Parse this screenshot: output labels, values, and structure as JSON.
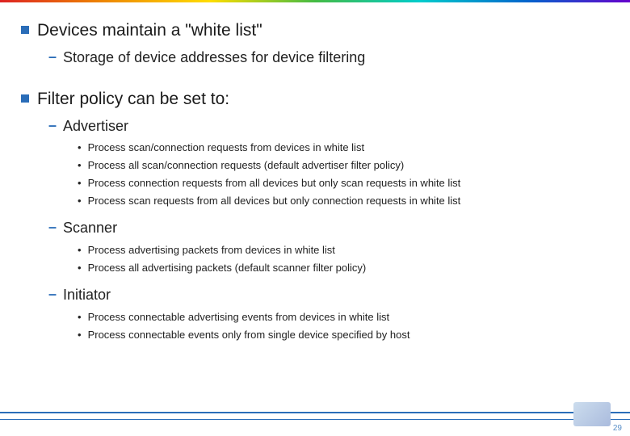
{
  "sections": [
    {
      "title": "Devices maintain a \"white list\"",
      "subs": [
        {
          "label": "Storage of device addresses for device filtering",
          "items": []
        }
      ]
    },
    {
      "title": "Filter policy can be set to:",
      "subs": [
        {
          "label": "Advertiser",
          "items": [
            "Process scan/connection requests from devices in white list",
            "Process all scan/connection requests (default advertiser filter policy)",
            "Process connection requests from all devices but only scan requests in white list",
            "Process scan requests from all devices but only connection requests in white list"
          ]
        },
        {
          "label": "Scanner",
          "items": [
            "Process advertising packets from devices in white list",
            "Process all advertising packets (default scanner filter policy)"
          ]
        },
        {
          "label": "Initiator",
          "items": [
            "Process connectable advertising events from devices in white list",
            "Process connectable events only from single device specified by host"
          ]
        }
      ]
    }
  ],
  "page_number": "29"
}
